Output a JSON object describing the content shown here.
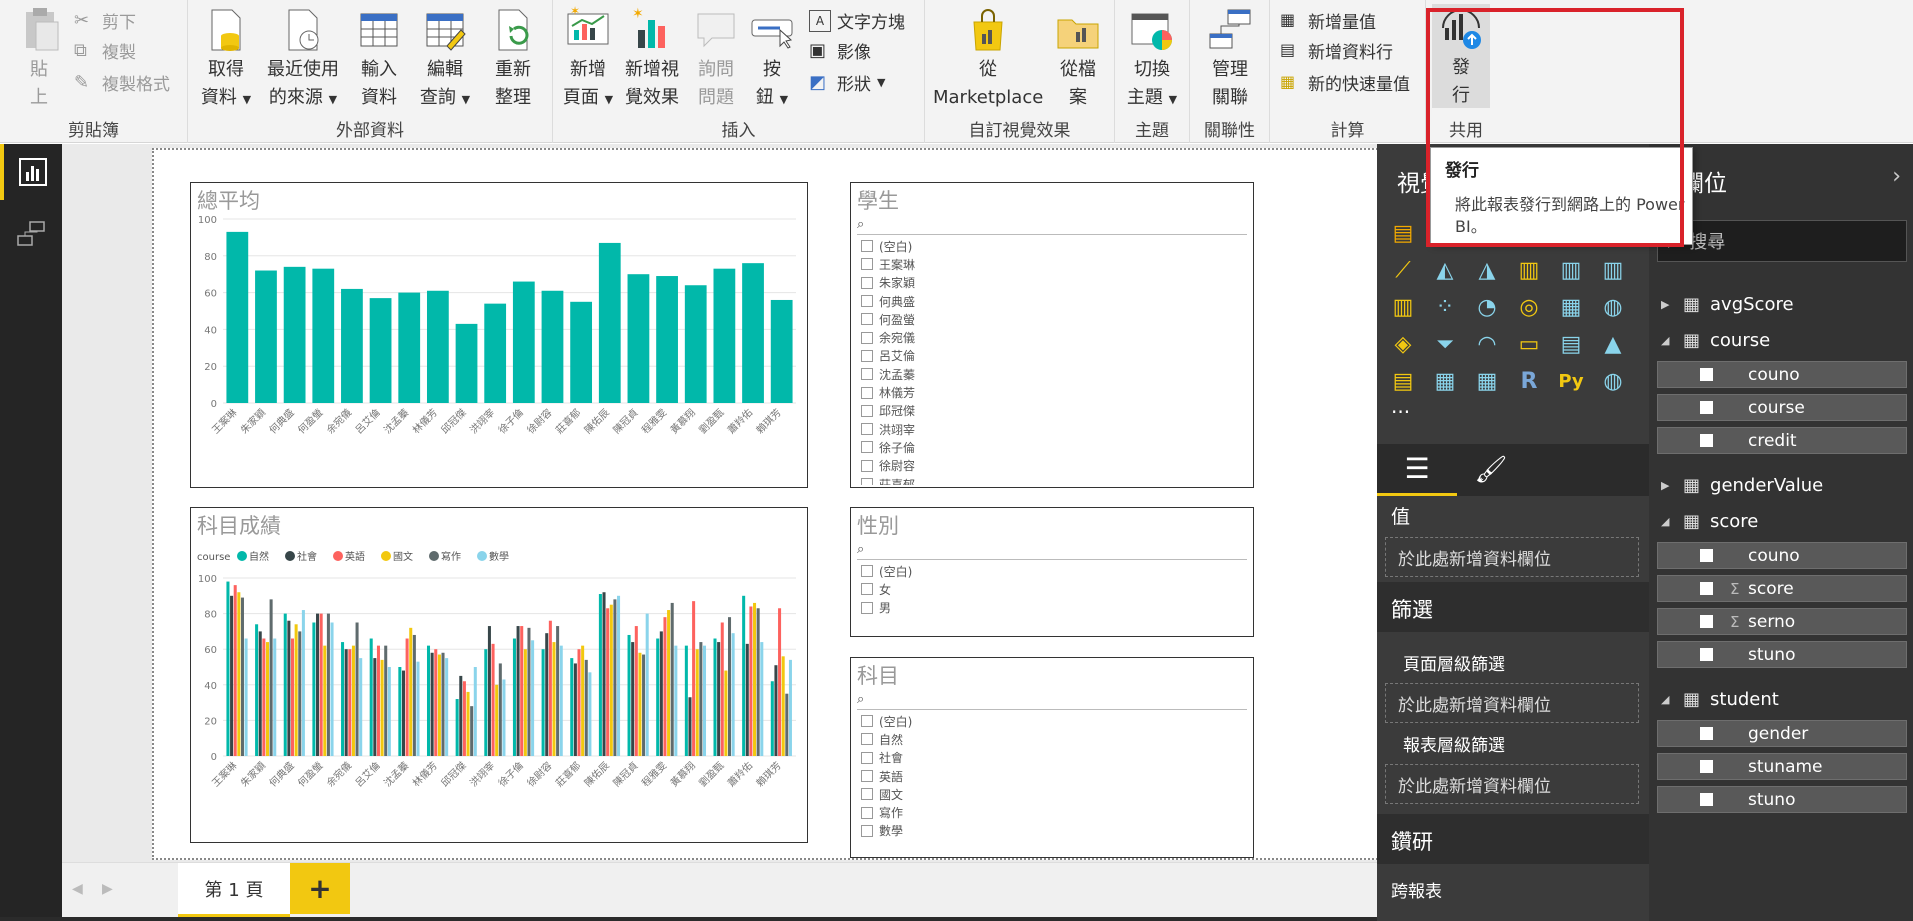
{
  "ribbon": {
    "clipboard": {
      "label": "剪貼簿",
      "paste": [
        "貼",
        "上"
      ],
      "cut": "剪下",
      "copy": "複製",
      "format_painter": "複製格式"
    },
    "external": {
      "label": "外部資料",
      "get_data": [
        "取得",
        "資料"
      ],
      "recent": [
        "最近使用",
        "的來源"
      ],
      "enter": [
        "輸入",
        "資料"
      ],
      "edit_query": [
        "編輯",
        "查詢"
      ],
      "refresh": [
        "重新",
        "整理"
      ]
    },
    "insert": {
      "label": "插入",
      "new_page": [
        "新增",
        "頁面"
      ],
      "new_visual": [
        "新增視",
        "覺效果"
      ],
      "ask": [
        "詢問",
        "問題"
      ],
      "button": [
        "按",
        "鈕"
      ],
      "textbox": "文字方塊",
      "image": "影像",
      "shapes": "形狀"
    },
    "custom": {
      "label": "自訂視覺效果",
      "marketplace": [
        "從",
        "Marketplace"
      ],
      "from_file": [
        "從檔",
        "案"
      ]
    },
    "theme": {
      "label": "主題",
      "switch": [
        "切換",
        "主題"
      ]
    },
    "relations": {
      "label": "關聯性",
      "manage": [
        "管理",
        "關聯"
      ]
    },
    "calc": {
      "label": "計算",
      "new_measure": "新增量值",
      "new_column": "新增資料行",
      "quick_measure": "新的快速量值"
    },
    "share": {
      "label": "共用",
      "publish": [
        "發",
        "行"
      ]
    }
  },
  "tooltip": {
    "title": "發行",
    "body": "將此報表發行到網路上的 Power BI。"
  },
  "visuals": {
    "avg": {
      "title": "總平均"
    },
    "subject": {
      "title": "科目成績",
      "legend_title": "course"
    },
    "student_slicer": {
      "title": "學生",
      "items": [
        "(空白)",
        "王案琳",
        "朱家穎",
        "何典盛",
        "何盈螢",
        "余宛儀",
        "呂艾倫",
        "沈孟蓁",
        "林儀芳",
        "邱冠傑",
        "洪翊宰",
        "徐子倫",
        "徐尉容",
        "莊喜郁"
      ]
    },
    "gender_slicer": {
      "title": "性別",
      "items": [
        "(空白)",
        "女",
        "男"
      ]
    },
    "course_slicer": {
      "title": "科目",
      "items": [
        "(空白)",
        "自然",
        "社會",
        "英語",
        "國文",
        "寫作",
        "數學"
      ]
    }
  },
  "chart_data": [
    {
      "type": "bar",
      "title": "總平均",
      "categories": [
        "王案琳",
        "朱家穎",
        "何典盛",
        "何盈螢",
        "余宛儀",
        "呂艾倫",
        "沈孟蓁",
        "林儀芳",
        "邱冠傑",
        "洪翊宰",
        "徐子倫",
        "徐尉容",
        "莊喜郁",
        "陳佑辰",
        "陳冠貞",
        "程雅雯",
        "黃慕翔",
        "劉盈甄",
        "蕭羚佑",
        "賴琪芳"
      ],
      "values": [
        93,
        72,
        74,
        73,
        62,
        57,
        60,
        61,
        43,
        54,
        66,
        61,
        55,
        87,
        70,
        69,
        64,
        73,
        76,
        56
      ],
      "ylim": [
        0,
        100
      ],
      "yticks": [
        0,
        20,
        40,
        60,
        80,
        100
      ],
      "color": "#01b8aa"
    },
    {
      "type": "bar",
      "title": "科目成績",
      "legend_title": "course",
      "categories": [
        "王案琳",
        "朱家穎",
        "何典盛",
        "何盈螢",
        "余宛儀",
        "呂艾倫",
        "沈孟蓁",
        "林儀芳",
        "邱冠傑",
        "洪翊宰",
        "徐子倫",
        "徐尉容",
        "莊喜郁",
        "陳佑辰",
        "陳冠貞",
        "程雅雯",
        "黃慕翔",
        "劉盈甄",
        "蕭羚佑",
        "賴琪芳"
      ],
      "ylim": [
        0,
        100
      ],
      "yticks": [
        0,
        20,
        40,
        60,
        80,
        100
      ],
      "series": [
        {
          "name": "自然",
          "color": "#01b8aa",
          "values": [
            98,
            74,
            80,
            75,
            64,
            66,
            50,
            62,
            32,
            60,
            66,
            60,
            55,
            91,
            68,
            66,
            62,
            66,
            90,
            42
          ]
        },
        {
          "name": "社會",
          "color": "#374649",
          "values": [
            90,
            70,
            76,
            80,
            60,
            55,
            48,
            58,
            45,
            73,
            73,
            69,
            52,
            92,
            64,
            70,
            33,
            64,
            63,
            51
          ]
        },
        {
          "name": "英語",
          "color": "#fd625e",
          "values": [
            96,
            66,
            66,
            80,
            60,
            62,
            66,
            60,
            42,
            63,
            73,
            76,
            60,
            83,
            73,
            78,
            87,
            75,
            84,
            83
          ]
        },
        {
          "name": "國文",
          "color": "#f2c80f",
          "values": [
            92,
            64,
            74,
            62,
            62,
            54,
            72,
            57,
            36,
            40,
            60,
            64,
            62,
            85,
            58,
            82,
            60,
            48,
            86,
            56
          ]
        },
        {
          "name": "寫作",
          "color": "#5f6b6d",
          "values": [
            89,
            88,
            70,
            80,
            75,
            62,
            68,
            58,
            28,
            52,
            72,
            73,
            54,
            88,
            57,
            86,
            64,
            78,
            83,
            35
          ]
        },
        {
          "name": "數學",
          "color": "#8ad4eb",
          "values": [
            66,
            66,
            82,
            75,
            55,
            50,
            53,
            55,
            50,
            43,
            65,
            62,
            47,
            90,
            80,
            62,
            62,
            69,
            64,
            54
          ]
        }
      ]
    }
  ],
  "page_tabs": {
    "page1": "第 1 頁",
    "add": "+"
  },
  "viz_pane": {
    "title": "視覺效果",
    "values_label": "值",
    "drop_here": "於此處新增資料欄位",
    "filters": "篩選",
    "page_filters": "頁面層級篩選",
    "report_filters": "報表層級篩選",
    "drillthrough": "鑽研",
    "cross_report": "跨報表",
    "more": "···",
    "r_label": "R",
    "py_label": "Py"
  },
  "fields_pane": {
    "title": "欄位",
    "search_placeholder": "搜尋",
    "tables": [
      {
        "name": "avgScore",
        "expanded": false
      },
      {
        "name": "course",
        "expanded": true,
        "fields": [
          {
            "name": "couno",
            "sigma": false
          },
          {
            "name": "course",
            "sigma": false
          },
          {
            "name": "credit",
            "sigma": false
          }
        ]
      },
      {
        "name": "genderValue",
        "expanded": false
      },
      {
        "name": "score",
        "expanded": true,
        "fields": [
          {
            "name": "couno",
            "sigma": false
          },
          {
            "name": "score",
            "sigma": true
          },
          {
            "name": "serno",
            "sigma": true
          },
          {
            "name": "stuno",
            "sigma": false
          }
        ]
      },
      {
        "name": "student",
        "expanded": true,
        "fields": [
          {
            "name": "gender",
            "sigma": false
          },
          {
            "name": "stuname",
            "sigma": false
          },
          {
            "name": "stuno",
            "sigma": false
          }
        ]
      }
    ]
  },
  "colors": {
    "accent": "#f2c811",
    "highlight": "#d9222a",
    "teal": "#01b8aa"
  }
}
